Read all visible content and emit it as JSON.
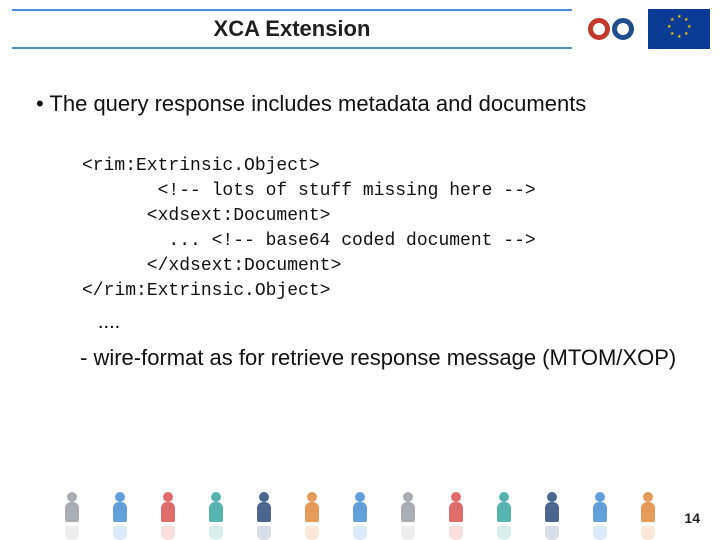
{
  "header": {
    "title": "XCA Extension"
  },
  "bullet": "• The query response includes metadata and documents",
  "code": "<rim:Extrinsic.Object>\n       <!-- lots of stuff missing here -->\n      <xdsext:Document>\n        ... <!-- base64 coded document --> \n      </xdsext:Document>\n</rim:Extrinsic.Object>",
  "ellipsis": "....",
  "subpoint": "- wire-format as for retrieve response message (MTOM/XOP)",
  "page_number": "14"
}
